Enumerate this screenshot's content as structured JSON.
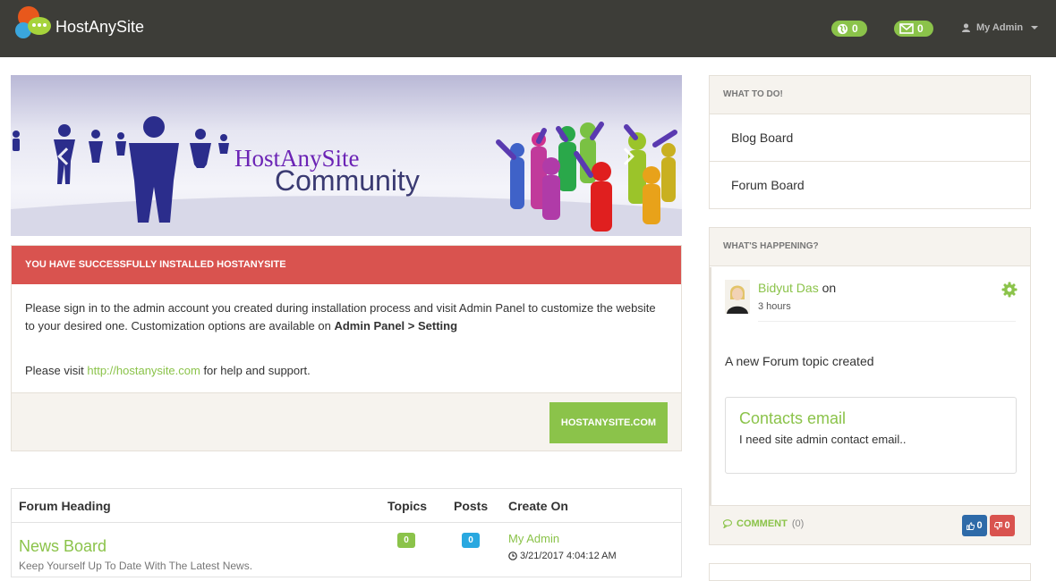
{
  "header": {
    "brand": "HostAnySite",
    "notifications_count": "0",
    "messages_count": "0",
    "user_menu_label": "My Admin"
  },
  "banner": {
    "line1": "HostAnySite",
    "line2": "Community"
  },
  "alert": {
    "title": "YOU HAVE SUCCESSFULLY INSTALLED HOSTANYSITE",
    "body_text": "Please sign in to the admin account you created during installation process and visit Admin Panel to customize the website to your desired one. Customization options are available on ",
    "body_bold": "Admin Panel > Setting",
    "visit_prefix": "Please visit ",
    "visit_link": "http://hostanysite.com",
    "visit_suffix": " for help and support.",
    "button_label": "HOSTANYSITE.COM"
  },
  "forum": {
    "columns": [
      "Forum Heading",
      "Topics",
      "Posts",
      "Create On"
    ],
    "rows": [
      {
        "title": "News Board",
        "description": "Keep Yourself Up To Date With The Latest News.",
        "topics": "0",
        "posts": "0",
        "creator": "My Admin",
        "created": "3/21/2017 4:04:12 AM"
      }
    ]
  },
  "sidebar": {
    "todo": {
      "title": "WHAT TO DO!",
      "items": [
        "Blog Board",
        "Forum Board"
      ]
    },
    "happening": {
      "title": "WHAT'S HAPPENING?",
      "user": "Bidyut Das",
      "user_suffix": " on",
      "time": "3 hours",
      "text": "A new Forum topic created",
      "topic_title": "Contacts email",
      "topic_desc": "I need site admin contact email..",
      "comment_label": "COMMENT",
      "comment_count": "(0)",
      "likes": "0",
      "dislikes": "0"
    }
  },
  "colors": {
    "topbar": "#3d3d38",
    "accent_green": "#8bc34a",
    "alert_red": "#d9534f",
    "badge_blue": "#29a8e0",
    "like_blue": "#2e6aa8"
  },
  "icons": [
    "logo-icon",
    "globe-icon",
    "envelope-icon",
    "user-icon",
    "chevron-left-icon",
    "chevron-right-icon",
    "clock-icon",
    "gear-icon",
    "comments-icon",
    "thumbs-up-icon",
    "thumbs-down-icon"
  ]
}
